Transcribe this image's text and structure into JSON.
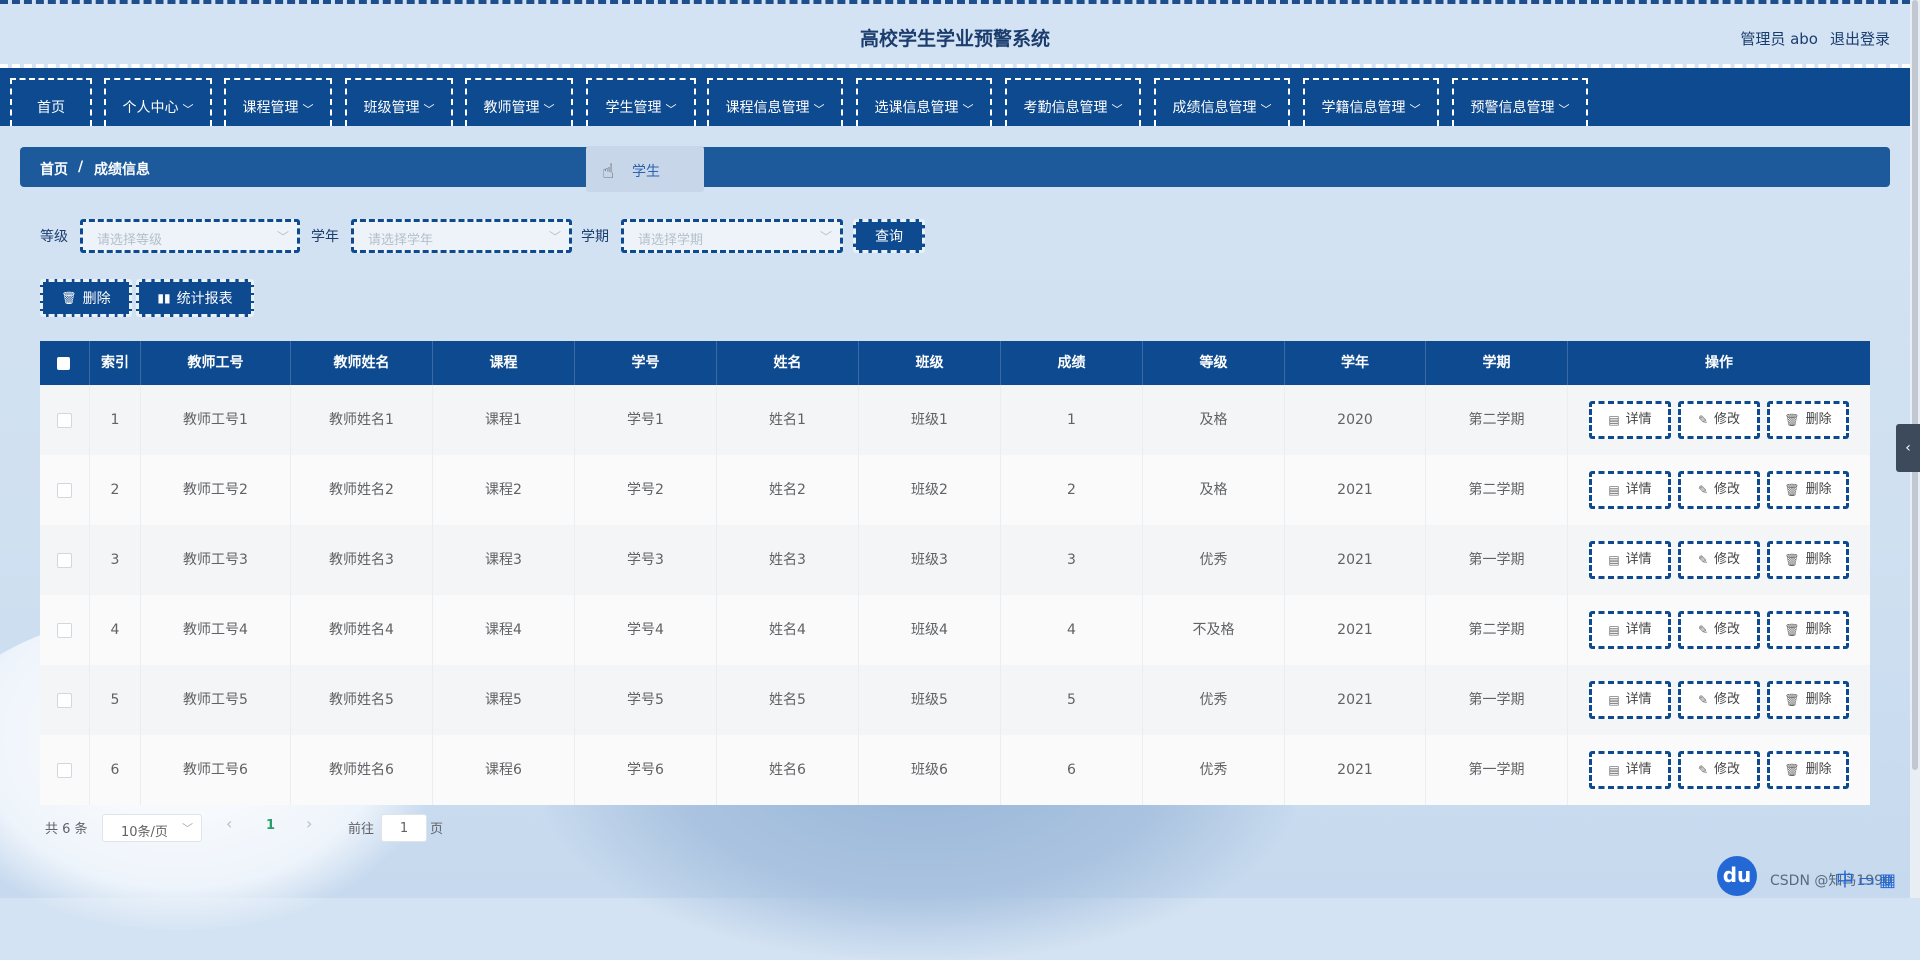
{
  "header": {
    "title": "高校学生学业预警系统",
    "user": "管理员 abo",
    "logout": "退出登录"
  },
  "nav": [
    {
      "label": "首页"
    },
    {
      "label": "个人中心"
    },
    {
      "label": "课程管理"
    },
    {
      "label": "班级管理"
    },
    {
      "label": "教师管理"
    },
    {
      "label": "学生管理"
    },
    {
      "label": "课程信息管理"
    },
    {
      "label": "选课信息管理"
    },
    {
      "label": "考勤信息管理"
    },
    {
      "label": "成绩信息管理"
    },
    {
      "label": "学籍信息管理"
    },
    {
      "label": "预警信息管理"
    }
  ],
  "dropdown": {
    "item": "学生"
  },
  "breadcrumb": {
    "home": "首页",
    "sep": "/",
    "current": "成绩信息"
  },
  "filters": {
    "grade": {
      "label": "等级",
      "placeholder": "请选择等级"
    },
    "year": {
      "label": "学年",
      "placeholder": "请选择学年"
    },
    "term": {
      "label": "学期",
      "placeholder": "请选择学期"
    },
    "query": "查询"
  },
  "actions": {
    "delete": "删除",
    "report": "统计报表"
  },
  "table": {
    "headers": [
      "索引",
      "教师工号",
      "教师姓名",
      "课程",
      "学号",
      "姓名",
      "班级",
      "成绩",
      "等级",
      "学年",
      "学期",
      "操作"
    ],
    "rows": [
      [
        "1",
        "教师工号1",
        "教师姓名1",
        "课程1",
        "学号1",
        "姓名1",
        "班级1",
        "1",
        "及格",
        "2020",
        "第二学期"
      ],
      [
        "2",
        "教师工号2",
        "教师姓名2",
        "课程2",
        "学号2",
        "姓名2",
        "班级2",
        "2",
        "及格",
        "2021",
        "第二学期"
      ],
      [
        "3",
        "教师工号3",
        "教师姓名3",
        "课程3",
        "学号3",
        "姓名3",
        "班级3",
        "3",
        "优秀",
        "2021",
        "第一学期"
      ],
      [
        "4",
        "教师工号4",
        "教师姓名4",
        "课程4",
        "学号4",
        "姓名4",
        "班级4",
        "4",
        "不及格",
        "2021",
        "第二学期"
      ],
      [
        "5",
        "教师工号5",
        "教师姓名5",
        "课程5",
        "学号5",
        "姓名5",
        "班级5",
        "5",
        "优秀",
        "2021",
        "第一学期"
      ],
      [
        "6",
        "教师工号6",
        "教师姓名6",
        "课程6",
        "学号6",
        "姓名6",
        "班级6",
        "6",
        "优秀",
        "2021",
        "第一学期"
      ]
    ],
    "ops": {
      "detail": "详情",
      "edit": "修改",
      "delete": "删除"
    }
  },
  "pagination": {
    "total": "共 6 条",
    "size": "10条/页",
    "prev": "‹",
    "page": "1",
    "next": "›",
    "goto": "前往",
    "goto_value": "1",
    "unit": "页"
  },
  "watermark": {
    "logo": "du",
    "text": "CSDN @知鸟1990"
  },
  "icons": {
    "trash": "trash-icon",
    "chart": "bar-chart-icon",
    "doc": "document-icon",
    "pencil": "pencil-icon",
    "chevron": "chevron-down-icon",
    "cursor": "hand-cursor-icon"
  }
}
